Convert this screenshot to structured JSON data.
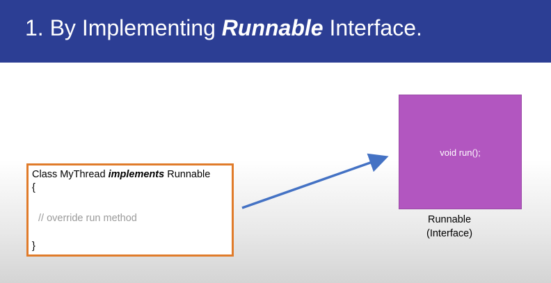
{
  "slide": {
    "title_prefix": "1. By Implementing ",
    "title_emphasis": "Runnable",
    "title_suffix": " Interface."
  },
  "code_box": {
    "line1_prefix": "Class MyThread ",
    "line1_keyword": "implements",
    "line1_suffix": " Runnable",
    "open_brace": "{",
    "comment": "// override run method",
    "close_brace": "}"
  },
  "interface_box": {
    "method": "void run();",
    "name": "Runnable",
    "kind": "(Interface)"
  },
  "colors": {
    "title_bar": "#2c3e94",
    "code_border": "#e07b2a",
    "interface_fill": "#b256c0",
    "arrow": "#4472c4"
  }
}
